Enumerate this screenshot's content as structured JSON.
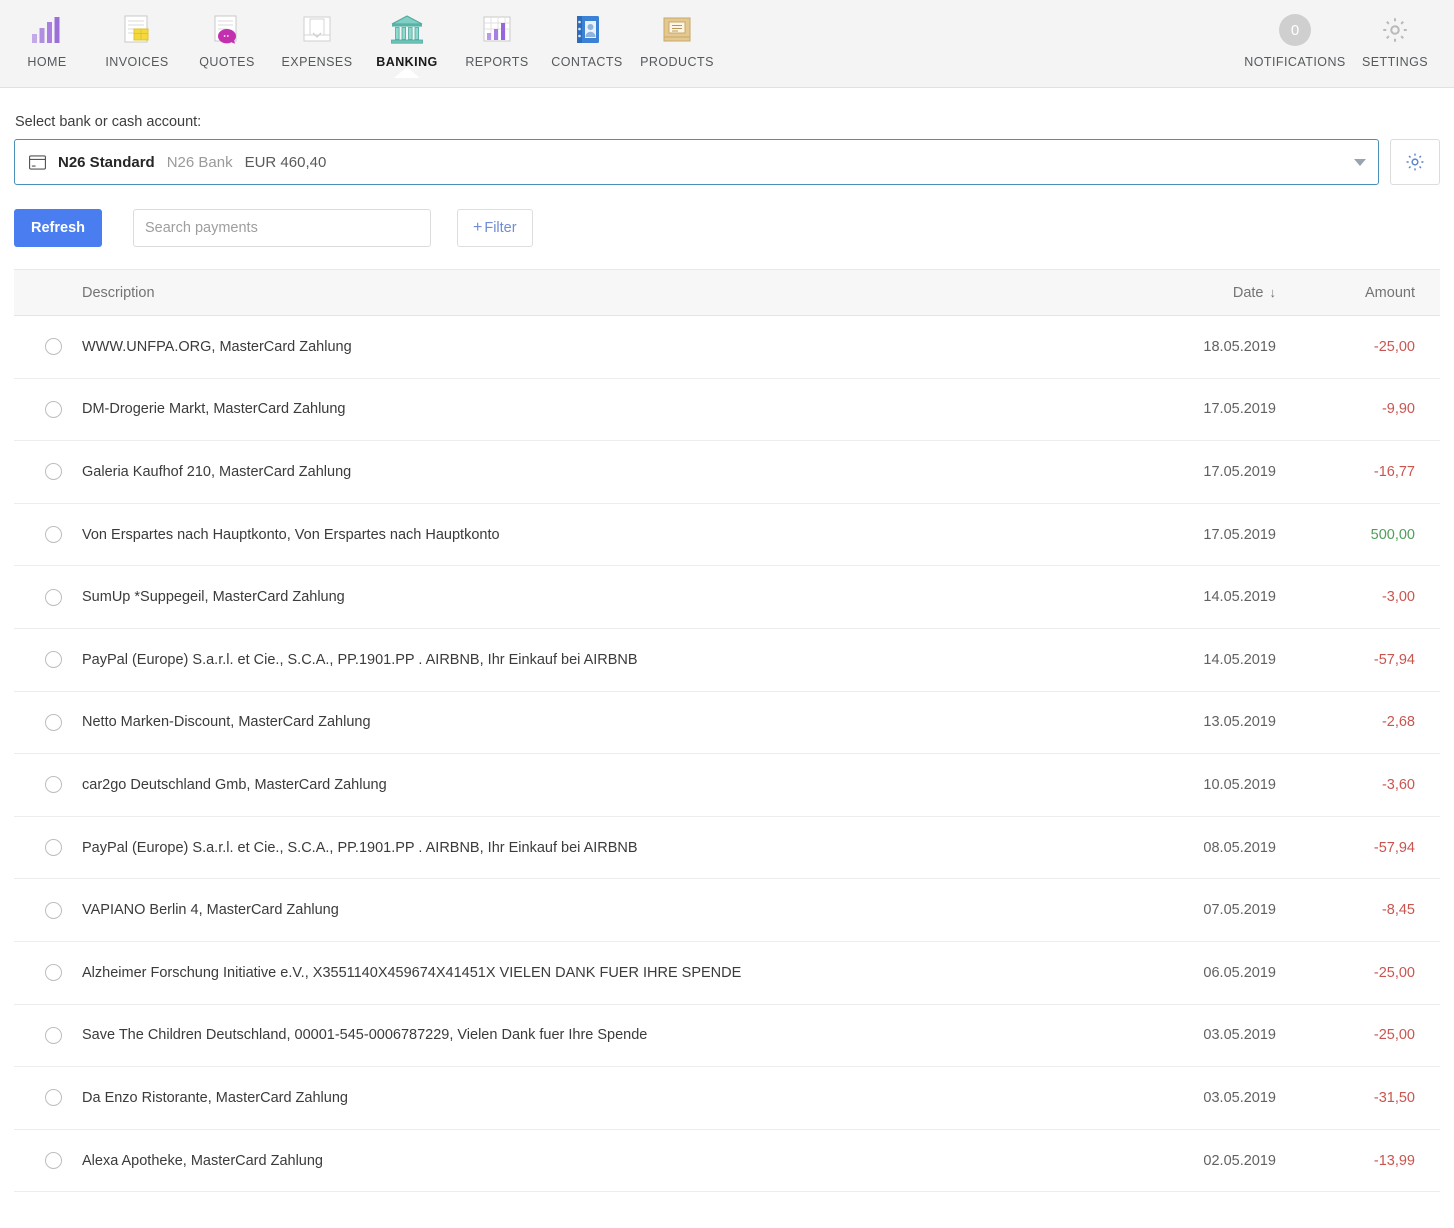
{
  "nav": {
    "items": [
      {
        "label": "HOME",
        "icon": "bar-chart-icon",
        "active": false
      },
      {
        "label": "INVOICES",
        "icon": "invoice-document-icon",
        "active": false
      },
      {
        "label": "QUOTES",
        "icon": "quote-speech-bubble-icon",
        "active": false
      },
      {
        "label": "EXPENSES",
        "icon": "expenses-receipt-icon",
        "active": false
      },
      {
        "label": "BANKING",
        "icon": "bank-building-icon",
        "active": true
      },
      {
        "label": "REPORTS",
        "icon": "reports-grid-chart-icon",
        "active": false
      },
      {
        "label": "CONTACTS",
        "icon": "contacts-address-book-icon",
        "active": false
      },
      {
        "label": "PRODUCTS",
        "icon": "products-box-icon",
        "active": false
      }
    ],
    "notifications": {
      "label": "NOTIFICATIONS",
      "count": "0"
    },
    "settings": {
      "label": "SETTINGS",
      "icon": "gear-icon"
    }
  },
  "account": {
    "label": "Select bank or cash account:",
    "icon": "bank-card-icon",
    "name": "N26 Standard",
    "bank": "N26 Bank",
    "balance": "EUR 460,40",
    "settings_icon": "gear-icon"
  },
  "toolbar": {
    "refresh_label": "Refresh",
    "search_placeholder": "Search payments",
    "search_value": "",
    "filter_plus": "+",
    "filter_label": "Filter"
  },
  "table": {
    "headers": {
      "description": "Description",
      "date": "Date",
      "sort_arrow": "↓",
      "amount": "Amount"
    },
    "rows": [
      {
        "description": "WWW.UNFPA.ORG, MasterCard Zahlung",
        "date": "18.05.2019",
        "amount": "-25,00",
        "positive": false
      },
      {
        "description": "DM-Drogerie Markt, MasterCard Zahlung",
        "date": "17.05.2019",
        "amount": "-9,90",
        "positive": false
      },
      {
        "description": "Galeria Kaufhof 210, MasterCard Zahlung",
        "date": "17.05.2019",
        "amount": "-16,77",
        "positive": false
      },
      {
        "description": "Von Erspartes nach Hauptkonto, Von Erspartes nach Hauptkonto",
        "date": "17.05.2019",
        "amount": "500,00",
        "positive": true
      },
      {
        "description": "SumUp *Suppegeil, MasterCard Zahlung",
        "date": "14.05.2019",
        "amount": "-3,00",
        "positive": false
      },
      {
        "description": "PayPal (Europe) S.a.r.l. et Cie., S.C.A., PP.1901.PP . AIRBNB, Ihr Einkauf bei AIRBNB",
        "date": "14.05.2019",
        "amount": "-57,94",
        "positive": false
      },
      {
        "description": "Netto Marken-Discount, MasterCard Zahlung",
        "date": "13.05.2019",
        "amount": "-2,68",
        "positive": false
      },
      {
        "description": "car2go Deutschland Gmb, MasterCard Zahlung",
        "date": "10.05.2019",
        "amount": "-3,60",
        "positive": false
      },
      {
        "description": "PayPal (Europe) S.a.r.l. et Cie., S.C.A., PP.1901.PP . AIRBNB, Ihr Einkauf bei AIRBNB",
        "date": "08.05.2019",
        "amount": "-57,94",
        "positive": false
      },
      {
        "description": "VAPIANO Berlin 4, MasterCard Zahlung",
        "date": "07.05.2019",
        "amount": "-8,45",
        "positive": false
      },
      {
        "description": "Alzheimer Forschung Initiative e.V., X3551140X459674X41451X VIELEN DANK FUER IHRE SPENDE",
        "date": "06.05.2019",
        "amount": "-25,00",
        "positive": false
      },
      {
        "description": "Save The Children Deutschland, 00001-545-0006787229, Vielen Dank fuer Ihre Spende",
        "date": "03.05.2019",
        "amount": "-25,00",
        "positive": false
      },
      {
        "description": "Da Enzo Ristorante, MasterCard Zahlung",
        "date": "03.05.2019",
        "amount": "-31,50",
        "positive": false
      },
      {
        "description": "Alexa Apotheke, MasterCard Zahlung",
        "date": "02.05.2019",
        "amount": "-13,99",
        "positive": false
      }
    ]
  },
  "colors": {
    "accent_blue": "#4a7ef0",
    "negative": "#c9554f",
    "positive": "#4f9e5a",
    "nav_bg": "#f4f4f4"
  }
}
